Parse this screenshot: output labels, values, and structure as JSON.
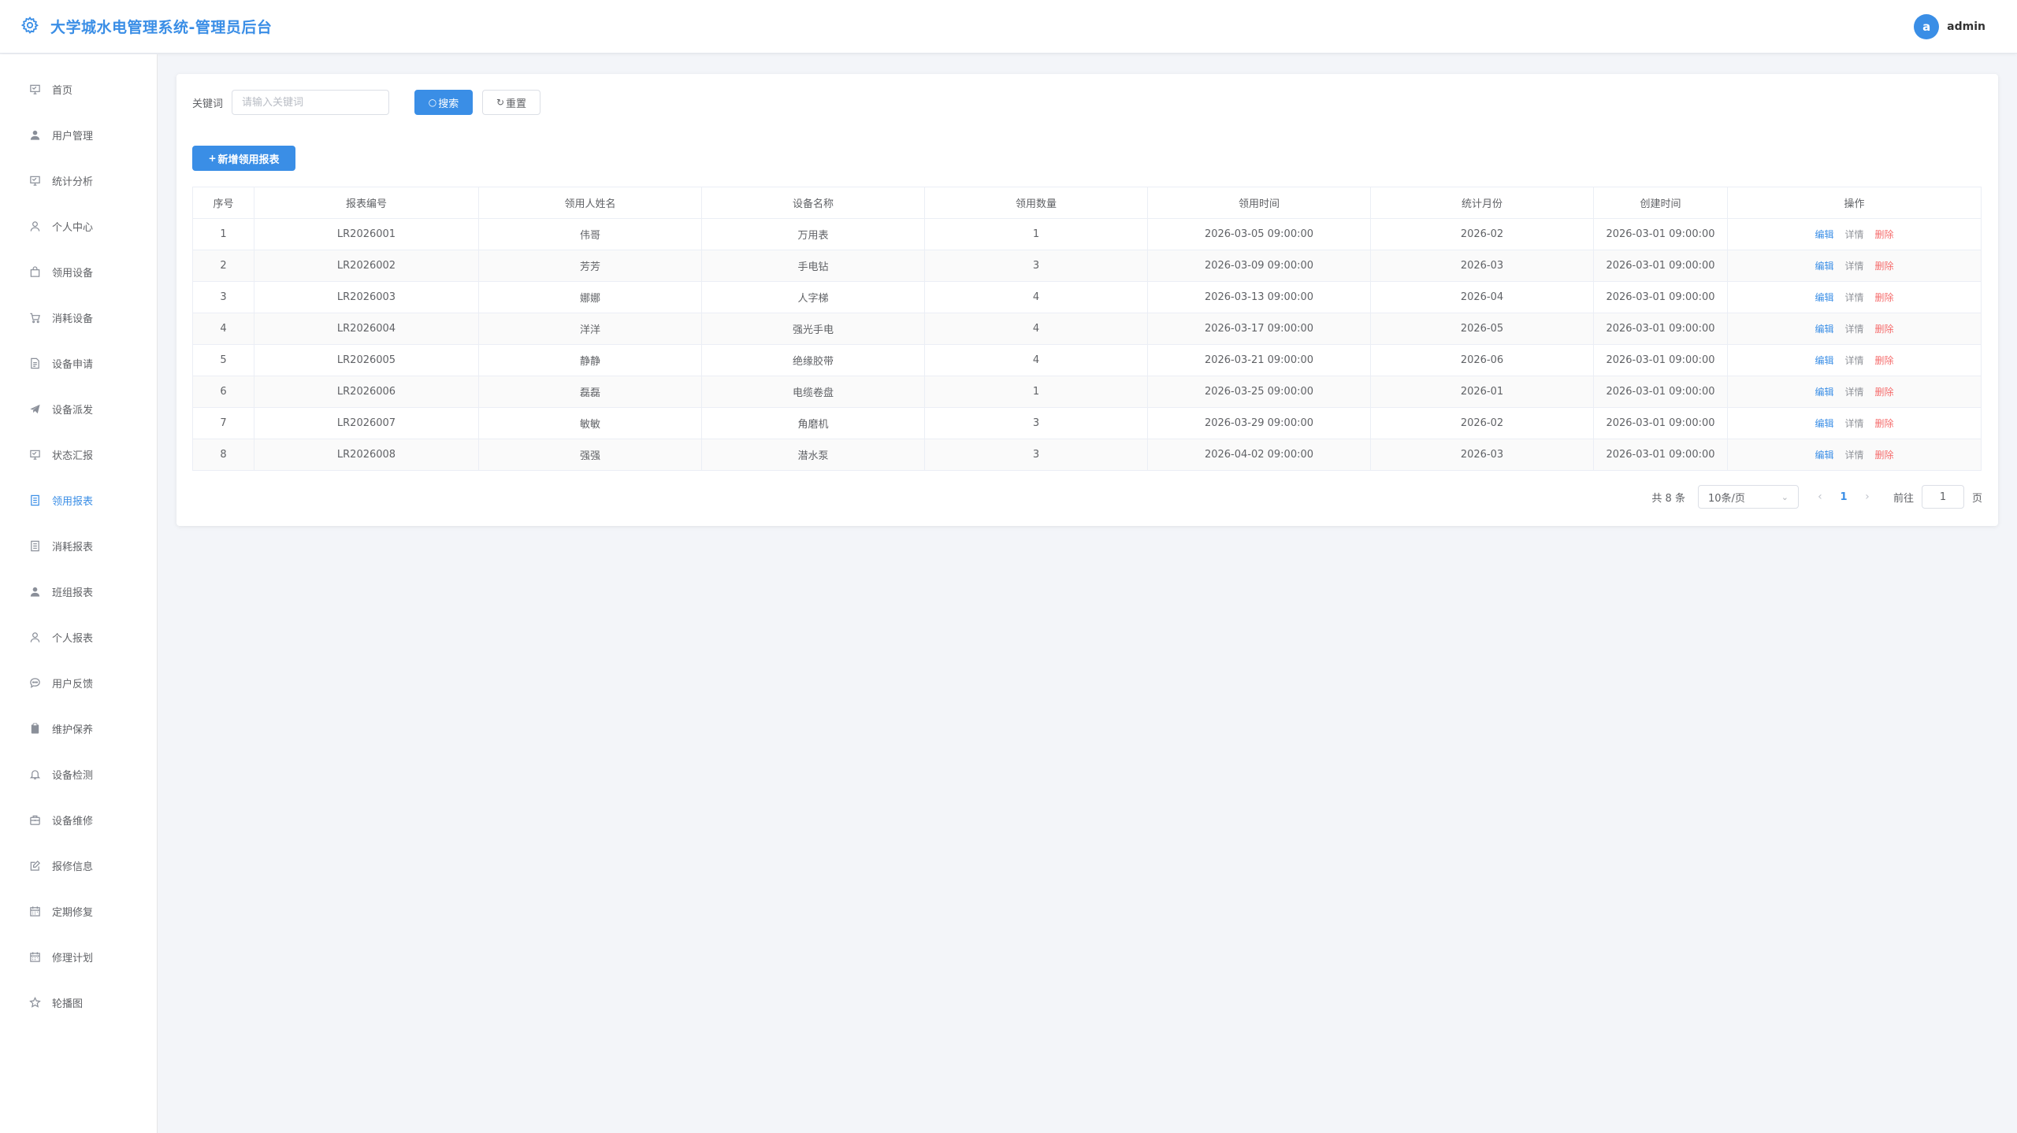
{
  "header": {
    "title": "大学城水电管理系统-管理员后台",
    "avatar_letter": "a",
    "username": "admin"
  },
  "sidebar": {
    "items": [
      {
        "label": "首页",
        "icon": "monitor-icon"
      },
      {
        "label": "用户管理",
        "icon": "user-solid-icon"
      },
      {
        "label": "统计分析",
        "icon": "monitor-icon"
      },
      {
        "label": "个人中心",
        "icon": "user-icon"
      },
      {
        "label": "领用设备",
        "icon": "bag-icon"
      },
      {
        "label": "消耗设备",
        "icon": "cart-icon"
      },
      {
        "label": "设备申请",
        "icon": "document-icon"
      },
      {
        "label": "设备派发",
        "icon": "send-icon"
      },
      {
        "label": "状态汇报",
        "icon": "monitor-icon"
      },
      {
        "label": "领用报表",
        "icon": "tickets-icon"
      },
      {
        "label": "消耗报表",
        "icon": "tickets-icon"
      },
      {
        "label": "班组报表",
        "icon": "user-solid-icon"
      },
      {
        "label": "个人报表",
        "icon": "user-icon"
      },
      {
        "label": "用户反馈",
        "icon": "chat-icon"
      },
      {
        "label": "维护保养",
        "icon": "clipboard-icon"
      },
      {
        "label": "设备检测",
        "icon": "bell-icon"
      },
      {
        "label": "设备维修",
        "icon": "toolbox-icon"
      },
      {
        "label": "报修信息",
        "icon": "edit-icon"
      },
      {
        "label": "定期修复",
        "icon": "calendar-icon"
      },
      {
        "label": "修理计划",
        "icon": "calendar-icon"
      },
      {
        "label": "轮播图",
        "icon": "star-icon"
      }
    ],
    "active_index": 9
  },
  "search": {
    "label": "关键词",
    "placeholder": "请输入关键词",
    "search_btn": "搜索",
    "reset_btn": "重置"
  },
  "add_button": "新增领用报表",
  "table": {
    "columns": [
      "序号",
      "报表编号",
      "领用人姓名",
      "设备名称",
      "领用数量",
      "领用时间",
      "统计月份",
      "创建时间",
      "操作"
    ],
    "rows": [
      [
        "1",
        "LR2026001",
        "伟哥",
        "万用表",
        "1",
        "2026-03-05 09:00:00",
        "2026-02",
        "2026-03-01 09:00:00"
      ],
      [
        "2",
        "LR2026002",
        "芳芳",
        "手电钻",
        "3",
        "2026-03-09 09:00:00",
        "2026-03",
        "2026-03-01 09:00:00"
      ],
      [
        "3",
        "LR2026003",
        "娜娜",
        "人字梯",
        "4",
        "2026-03-13 09:00:00",
        "2026-04",
        "2026-03-01 09:00:00"
      ],
      [
        "4",
        "LR2026004",
        "洋洋",
        "强光手电",
        "4",
        "2026-03-17 09:00:00",
        "2026-05",
        "2026-03-01 09:00:00"
      ],
      [
        "5",
        "LR2026005",
        "静静",
        "绝缘胶带",
        "4",
        "2026-03-21 09:00:00",
        "2026-06",
        "2026-03-01 09:00:00"
      ],
      [
        "6",
        "LR2026006",
        "磊磊",
        "电缆卷盘",
        "1",
        "2026-03-25 09:00:00",
        "2026-01",
        "2026-03-01 09:00:00"
      ],
      [
        "7",
        "LR2026007",
        "敏敏",
        "角磨机",
        "3",
        "2026-03-29 09:00:00",
        "2026-02",
        "2026-03-01 09:00:00"
      ],
      [
        "8",
        "LR2026008",
        "强强",
        "潜水泵",
        "3",
        "2026-04-02 09:00:00",
        "2026-03",
        "2026-03-01 09:00:00"
      ]
    ],
    "actions": {
      "edit": "编辑",
      "detail": "详情",
      "delete": "删除"
    }
  },
  "pagination": {
    "total_text": "共 8 条",
    "page_size": "10条/页",
    "current_page": "1",
    "goto_label": "前往",
    "goto_value": "1",
    "page_suffix": "页"
  },
  "colors": {
    "primary": "#3a8ee6",
    "danger": "#f56c6c",
    "background": "#f3f5f9"
  }
}
